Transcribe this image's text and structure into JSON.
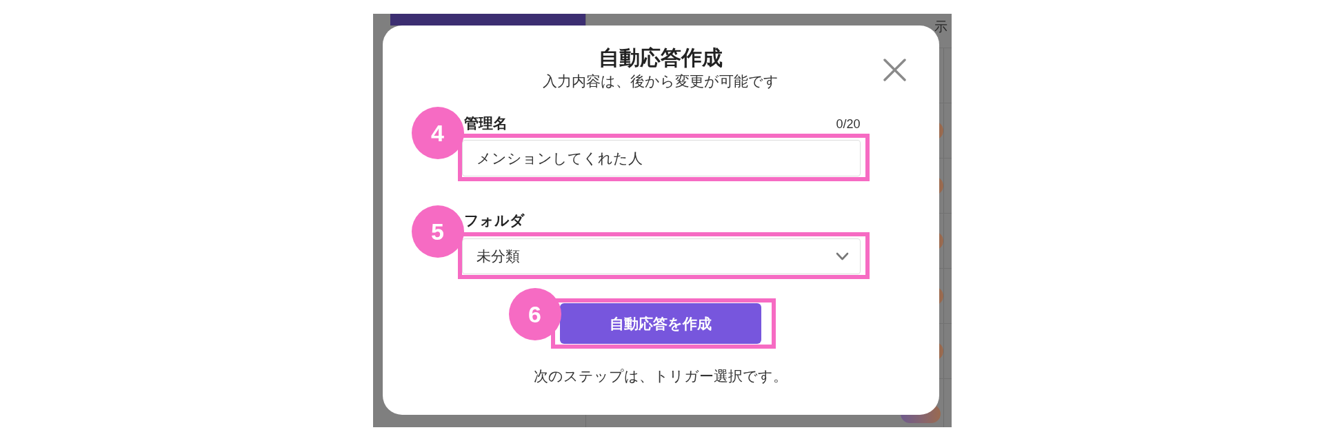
{
  "background": {
    "header_text": "示"
  },
  "dialog": {
    "title": "自動応答作成",
    "subtitle": "入力内容は、後から変更が可能です",
    "fields": [
      {
        "kind": "text",
        "label": "管理名",
        "counter": "0/20",
        "placeholder": "メンションしてくれた人",
        "marker": "4"
      },
      {
        "kind": "select",
        "label": "フォルダ",
        "value": "未分類",
        "marker": "5"
      }
    ],
    "submit": {
      "label": "自動応答を作成",
      "marker": "6"
    },
    "note": "次のステップは、トリガー選択です。"
  }
}
